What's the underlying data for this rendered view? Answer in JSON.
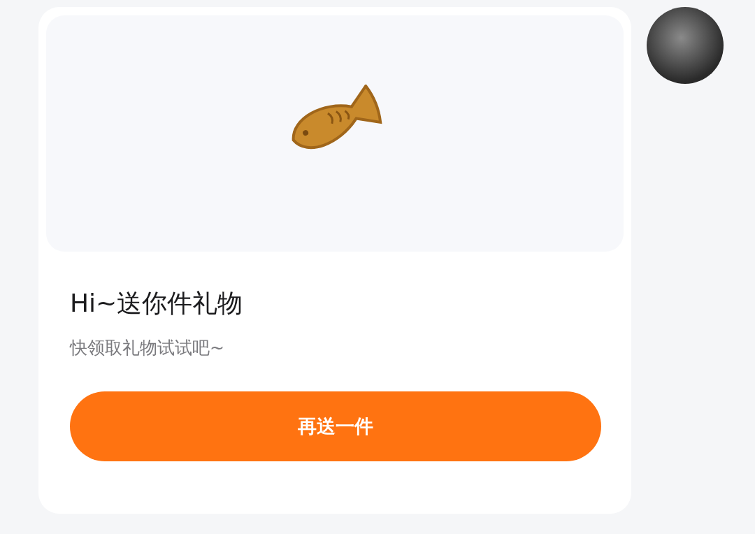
{
  "message": {
    "title": "Hi~送你件礼物",
    "subtitle": "快领取礼物试试吧~",
    "button": "再送一件"
  }
}
